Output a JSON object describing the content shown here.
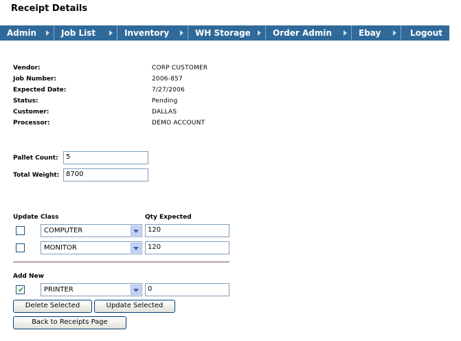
{
  "page": {
    "title": "Receipt Details"
  },
  "nav": [
    {
      "label": "Admin"
    },
    {
      "label": "Job List"
    },
    {
      "label": "Inventory"
    },
    {
      "label": "WH Storage"
    },
    {
      "label": "Order Admin"
    },
    {
      "label": "Ebay"
    },
    {
      "label": "Logout"
    }
  ],
  "info": [
    {
      "label": "Vendor:",
      "value": "CORP CUSTOMER"
    },
    {
      "label": "Job Number:",
      "value": "2006-857"
    },
    {
      "label": "Expected Date:",
      "value": "7/27/2006"
    },
    {
      "label": "Status:",
      "value": "Pending"
    },
    {
      "label": "Customer:",
      "value": "DALLAS"
    },
    {
      "label": "Processor:",
      "value": "DEMO ACCOUNT"
    }
  ],
  "pallet": {
    "label": "Pallet Count:",
    "value": "5"
  },
  "weight": {
    "label": "Total Weight:",
    "value": "8700"
  },
  "table": {
    "col_update": "Update",
    "col_class": "Class",
    "col_qty": "Qty Expected",
    "rows": [
      {
        "checked": false,
        "class": "COMPUTER",
        "qty": "120"
      },
      {
        "checked": false,
        "class": "MONITOR",
        "qty": "120"
      }
    ]
  },
  "add_new": {
    "label": "Add New",
    "checked": true,
    "class": "PRINTER",
    "qty": "0"
  },
  "buttons": {
    "delete": "Delete Selected",
    "update": "Update Selected",
    "back": "Back to Receipts Page"
  }
}
